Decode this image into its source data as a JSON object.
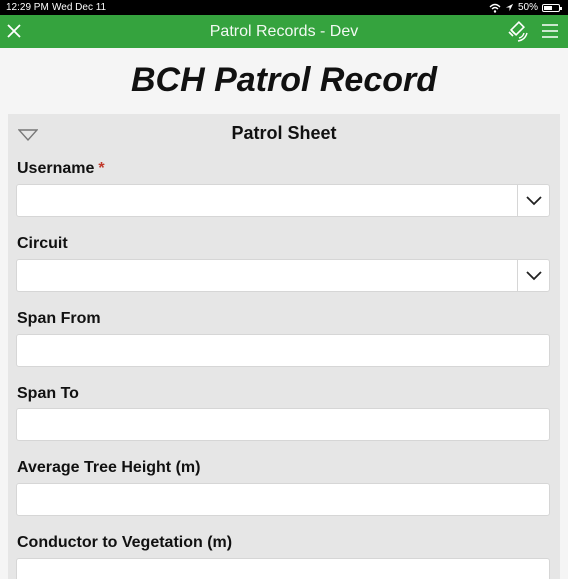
{
  "status_bar": {
    "time": "12:29 PM",
    "date": "Wed Dec 11",
    "battery": "50%"
  },
  "app_bar": {
    "title": "Patrol Records - Dev"
  },
  "form": {
    "title": "BCH Patrol Record"
  },
  "section": {
    "title": "Patrol Sheet"
  },
  "fields": [
    {
      "label": "Username",
      "required": true,
      "type": "select",
      "value": ""
    },
    {
      "label": "Circuit",
      "required": false,
      "type": "select",
      "value": ""
    },
    {
      "label": "Span From",
      "required": false,
      "type": "text",
      "value": ""
    },
    {
      "label": "Span To",
      "required": false,
      "type": "text",
      "value": ""
    },
    {
      "label": "Average Tree Height (m)",
      "required": false,
      "type": "text",
      "value": ""
    },
    {
      "label": "Conductor to Vegetation (m)",
      "required": false,
      "type": "text",
      "value": ""
    }
  ],
  "required_marker": "*",
  "colors": {
    "app_bar": "#35a33e",
    "required": "#c0392b"
  }
}
